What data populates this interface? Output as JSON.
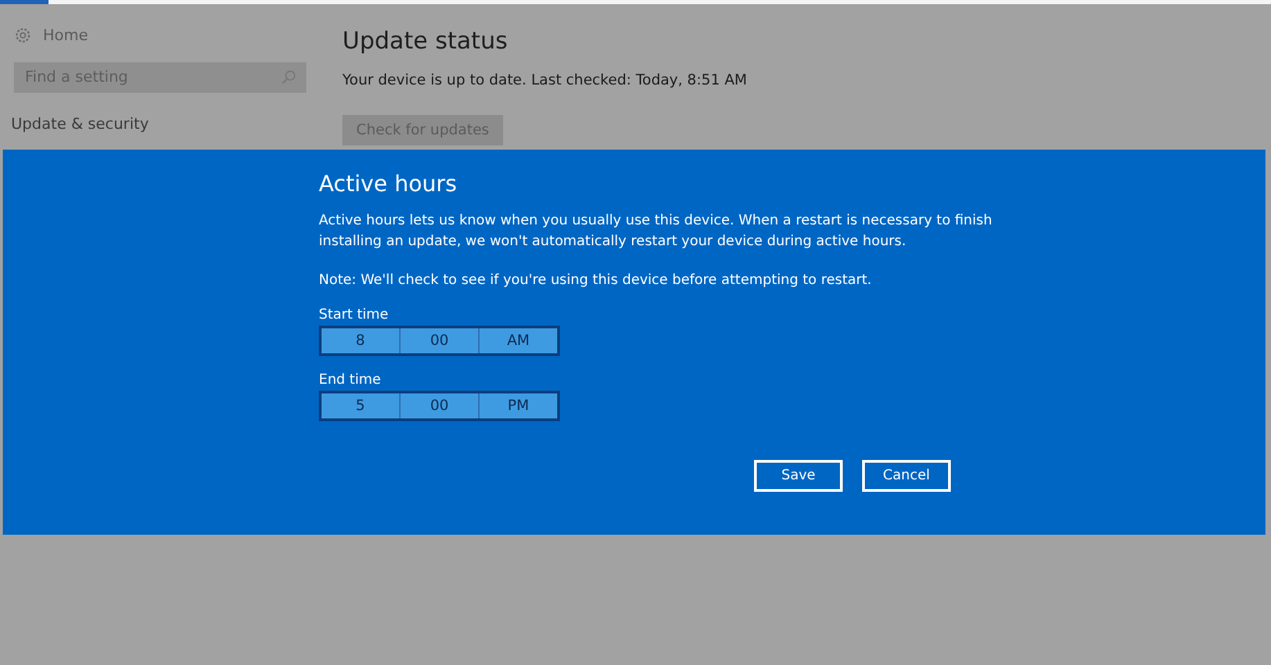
{
  "sidebar": {
    "home": "Home",
    "search": {
      "placeholder": "Find a setting"
    },
    "section": "Update & security"
  },
  "main": {
    "title": "Update status",
    "status": "Your device is up to date. Last checked: Today, 8:51 AM",
    "button": "Check for updates"
  },
  "dialog": {
    "title": "Active hours",
    "description": "Active hours lets us know when you usually use this device. When a restart is necessary to finish installing an update, we won't automatically restart your device during active hours.",
    "note": "Note: We'll check to see if you're using this device before attempting to restart.",
    "times": [
      {
        "label": "Start time",
        "hour": "8",
        "minute": "00",
        "period": "AM"
      },
      {
        "label": "End time",
        "hour": "5",
        "minute": "00",
        "period": "PM"
      }
    ],
    "buttons": [
      "Save",
      "Cancel"
    ]
  }
}
